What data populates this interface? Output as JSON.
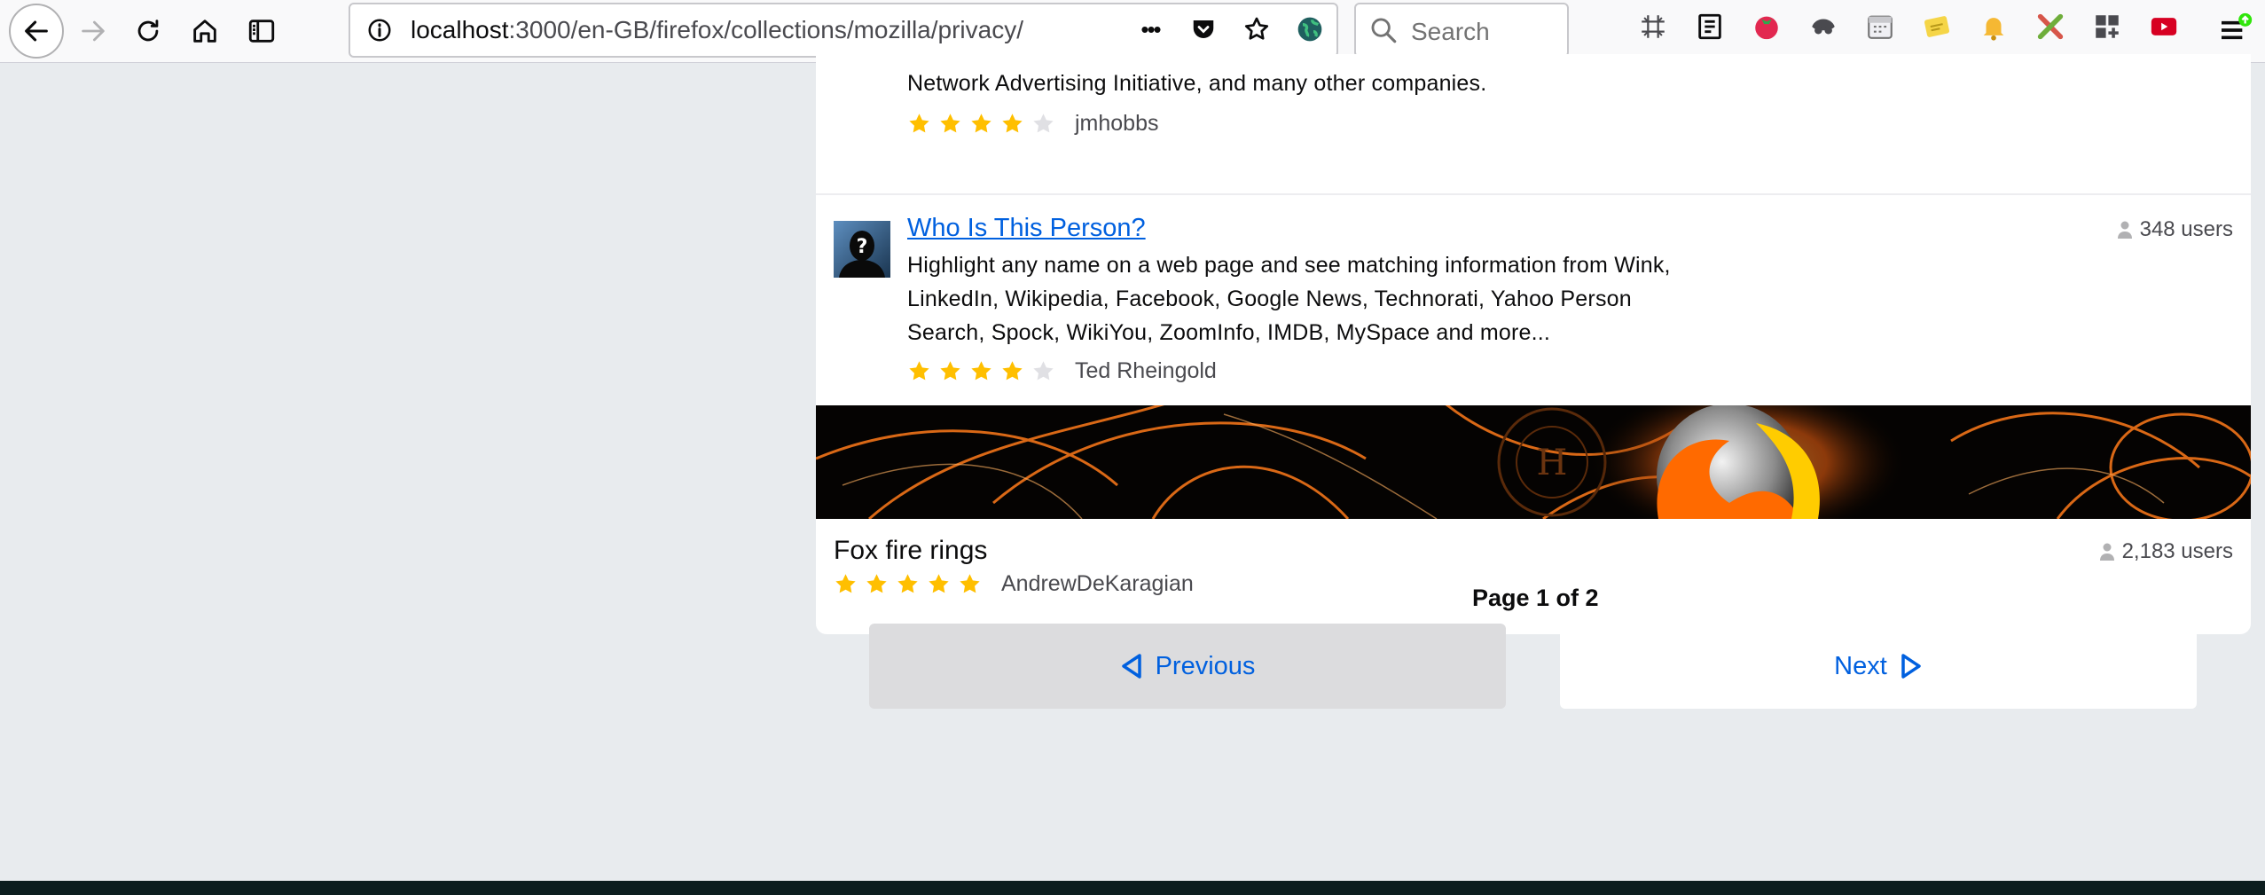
{
  "browser": {
    "url_host": "localhost",
    "url_rest": ":3000/en-GB/firefox/collections/mozilla/privacy/",
    "search_placeholder": "Search",
    "overflow_glyph": "•••"
  },
  "addons": [
    {
      "description": "Network Advertising Initiative, and many other companies.",
      "rating": 4,
      "author": "jmhobbs"
    },
    {
      "title": "Who Is This Person?",
      "description": "Highlight any name on a web page and see matching information from Wink, LinkedIn, Wikipedia, Facebook, Google News, Technorati, Yahoo Person Search, Spock, WikiYou, ZoomInfo, IMDB, MySpace and more...",
      "rating": 4,
      "author": "Ted Rheingold",
      "users": "348 users"
    },
    {
      "title": "Fox fire rings",
      "rating": 5,
      "author": "AndrewDeKaragian",
      "users": "2,183 users"
    }
  ],
  "pagination": {
    "label": "Page 1 of 2",
    "previous": "Previous",
    "next": "Next"
  },
  "colors": {
    "accent": "#0060df",
    "star": "#ffbf00",
    "star_empty": "#e0e0e4"
  }
}
